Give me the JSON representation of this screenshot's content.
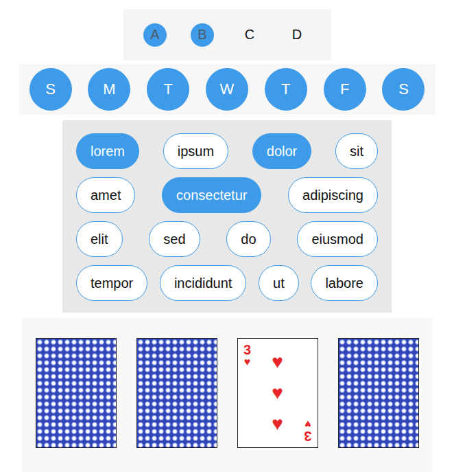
{
  "choices": [
    {
      "label": "A",
      "selected": true
    },
    {
      "label": "B",
      "selected": true
    },
    {
      "label": "C",
      "selected": false
    },
    {
      "label": "D",
      "selected": false
    }
  ],
  "days": [
    {
      "label": "S",
      "selected": true
    },
    {
      "label": "M",
      "selected": true
    },
    {
      "label": "T",
      "selected": true
    },
    {
      "label": "W",
      "selected": true
    },
    {
      "label": "T",
      "selected": true
    },
    {
      "label": "F",
      "selected": true
    },
    {
      "label": "S",
      "selected": true
    }
  ],
  "tags": [
    {
      "label": "lorem",
      "selected": true
    },
    {
      "label": "ipsum",
      "selected": false
    },
    {
      "label": "dolor",
      "selected": true
    },
    {
      "label": "sit",
      "selected": false
    },
    {
      "label": "amet",
      "selected": false
    },
    {
      "label": "consectetur",
      "selected": true
    },
    {
      "label": "adipiscing",
      "selected": false
    },
    {
      "label": "elit",
      "selected": false
    },
    {
      "label": "sed",
      "selected": false
    },
    {
      "label": "do",
      "selected": false
    },
    {
      "label": "eiusmod",
      "selected": false
    },
    {
      "label": "tempor",
      "selected": false
    },
    {
      "label": "incididunt",
      "selected": false
    },
    {
      "label": "ut",
      "selected": false
    },
    {
      "label": "labore",
      "selected": false
    }
  ],
  "cards": [
    {
      "face_up": false
    },
    {
      "face_up": false
    },
    {
      "face_up": true,
      "rank": "3",
      "suit": "♥"
    },
    {
      "face_up": false
    }
  ]
}
